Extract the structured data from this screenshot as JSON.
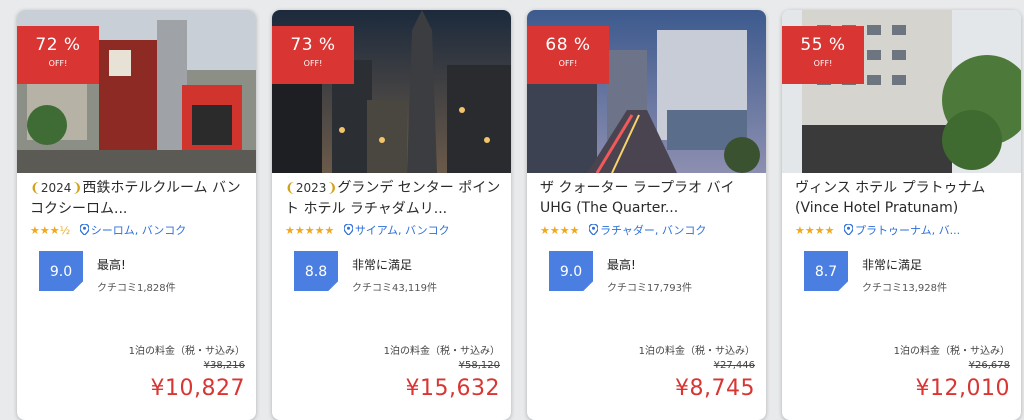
{
  "cards": [
    {
      "discount": "72 %",
      "off_label": "OFF!",
      "year": "2024",
      "name": "西鉄ホテルクルーム バンコクシーロム...",
      "stars": "★★★½",
      "location": "シーロム, バンコク",
      "score": "9.0",
      "rating_label": "最高!",
      "reviews": "クチコミ1,828件",
      "price_note": "1泊の料金（税・サ込み）",
      "original_price": "¥38,216",
      "price": "¥10,827"
    },
    {
      "discount": "73 %",
      "off_label": "OFF!",
      "year": "2023",
      "name": "グランデ センター ポイント ホテル ラチャダムリ...",
      "stars": "★★★★★",
      "location": "サイアム, バンコク",
      "score": "8.8",
      "rating_label": "非常に満足",
      "reviews": "クチコミ43,119件",
      "price_note": "1泊の料金（税・サ込み）",
      "original_price": "¥58,120",
      "price": "¥15,632"
    },
    {
      "discount": "68 %",
      "off_label": "OFF!",
      "year": "",
      "name": "ザ クォーター ラープラオ バイ UHG (The Quarter...",
      "stars": "★★★★",
      "location": "ラチャダー, バンコク",
      "score": "9.0",
      "rating_label": "最高!",
      "reviews": "クチコミ17,793件",
      "price_note": "1泊の料金（税・サ込み）",
      "original_price": "¥27,446",
      "price": "¥8,745"
    },
    {
      "discount": "55 %",
      "off_label": "OFF!",
      "year": "",
      "name": "ヴィンス ホテル プラトゥナム (Vince Hotel Pratunam)",
      "stars": "★★★★",
      "location": "プラトゥーナム, バ...",
      "score": "8.7",
      "rating_label": "非常に満足",
      "reviews": "クチコミ13,928件",
      "price_note": "1泊の料金（税・サ込み）",
      "original_price": "¥26,678",
      "price": "¥12,010"
    }
  ],
  "colors": {
    "discount_badge": "#d93533",
    "score_badge": "#4a7fe1",
    "price": "#d93533",
    "stars": "#f0a81f",
    "location": "#2e6fd9"
  }
}
